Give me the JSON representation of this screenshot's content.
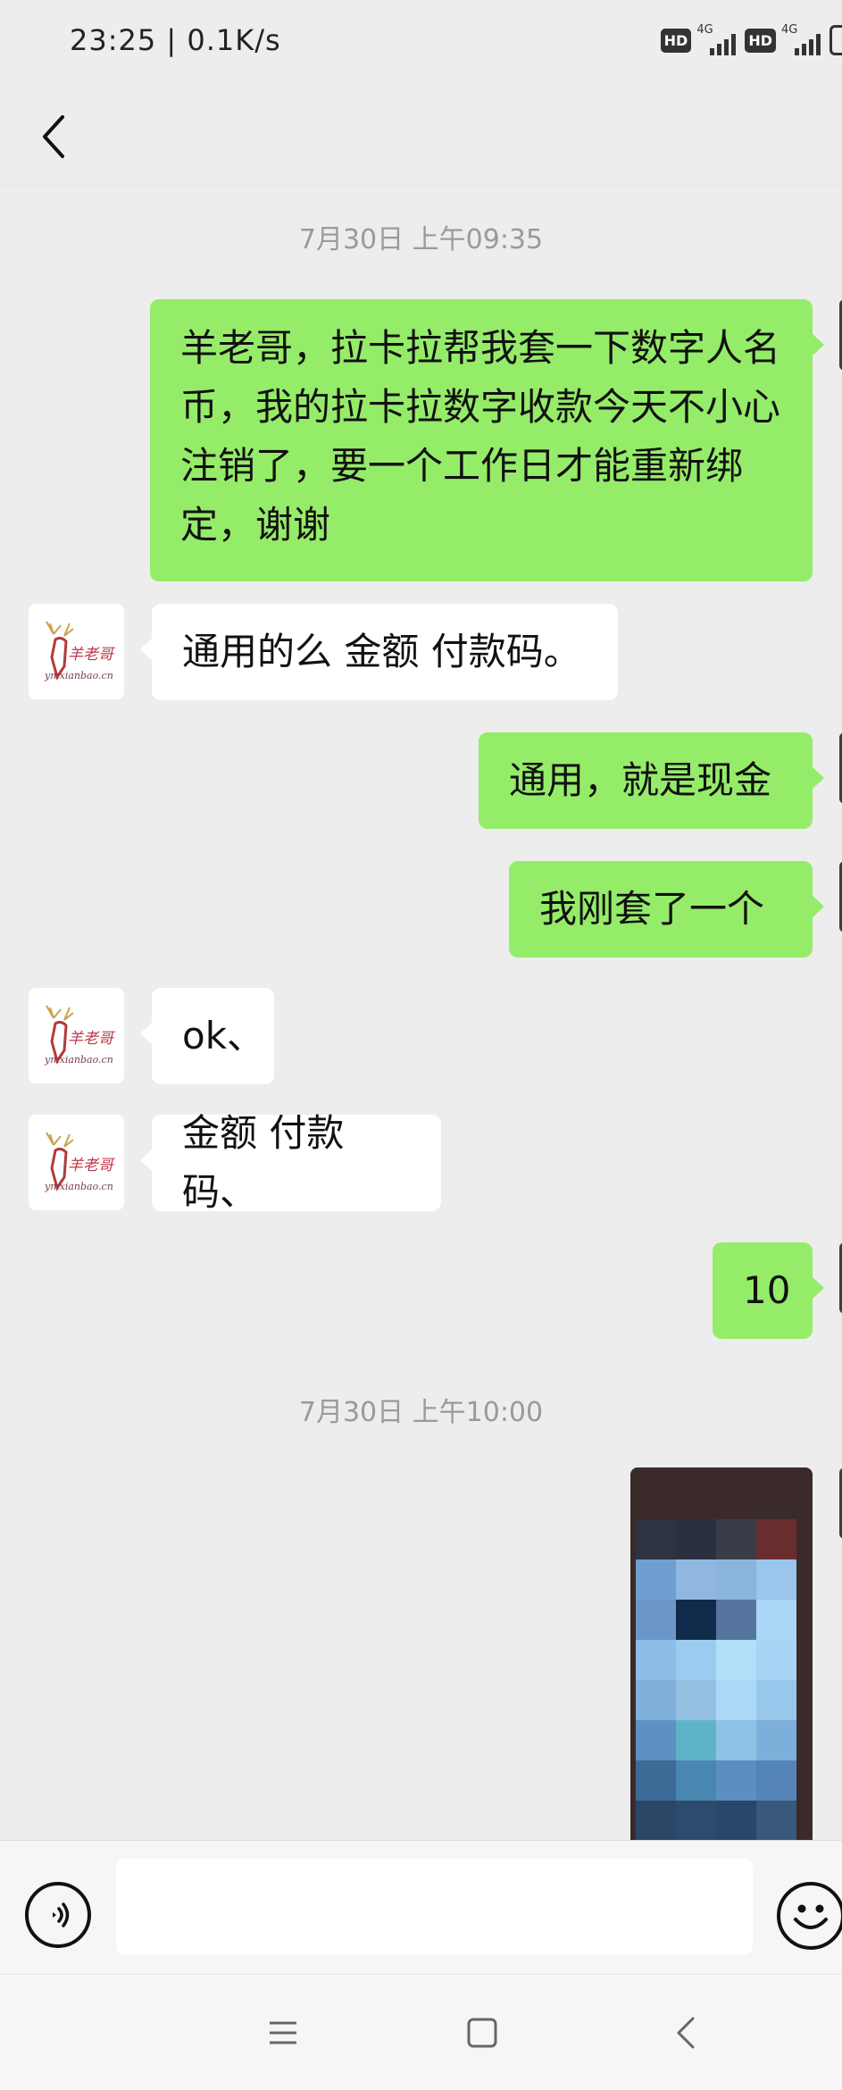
{
  "status_bar": {
    "time": "23:25 | 0.1K/s",
    "hd_badge": "HD",
    "network_type": "4G"
  },
  "chat": {
    "timestamps": [
      "7月30日 上午09:35",
      "7月30日 上午10:00"
    ],
    "messages": [
      {
        "side": "out",
        "text": "羊老哥，拉卡拉帮我套一下数字人名币，我的拉卡拉数字收款今天不小心注销了，要一个工作日才能重新绑定，谢谢"
      },
      {
        "side": "in",
        "text": "通用的么 金额 付款码。"
      },
      {
        "side": "out",
        "text": "通用，就是现金"
      },
      {
        "side": "out",
        "text": "我刚套了一个"
      },
      {
        "side": "in",
        "text": "ok、"
      },
      {
        "side": "in",
        "text": "金额 付款码、"
      },
      {
        "side": "out",
        "text": "10"
      }
    ],
    "contact_avatar": {
      "logo_text": "羊老哥",
      "logo_url_text": "ymxianbao.cn"
    },
    "image_message": {
      "type": "pixelated-image"
    }
  },
  "input_bar": {
    "placeholder": "",
    "value": ""
  },
  "colors": {
    "background": "#ededed",
    "outgoing_bubble": "#95ec69",
    "incoming_bubble": "#ffffff",
    "timestamp_text": "#9a9a9a"
  }
}
